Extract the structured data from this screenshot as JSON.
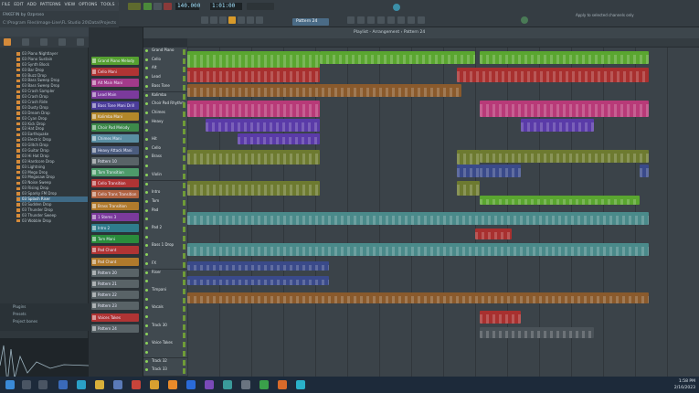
{
  "window": {
    "title": "FAKEFIN by Ozproso",
    "subtitle": "C:\\Program Files\\Image-Line\\FL Studio 20\\Data\\Projects"
  },
  "menu": [
    "FILE",
    "EDIT",
    "ADD",
    "PATTERNS",
    "VIEW",
    "OPTIONS",
    "TOOLS",
    "HELP"
  ],
  "transport": {
    "tempo": "140.000",
    "time": "1:01:00",
    "pattern": "Pattern 24",
    "hint": "Apply to selected channels only"
  },
  "playlist": {
    "title": "Playlist - Arrangement › Pattern 24"
  },
  "browser": {
    "items": [
      "03 Piano Nightlayer",
      "03 Piano Sustain",
      "03 Synth Block",
      "03 Bar Drop",
      "03 Buzz Drop",
      "03 Bass Sweep Drop",
      "03 Bass Sweep Drop",
      "03 Crash Sampler",
      "03 Crash Drop",
      "03 Crash Ride",
      "03 Dusty Drop",
      "03 Dream Drop",
      "03 Cyan Drop",
      "03 Kick Drop",
      "03 Hat Drop",
      "03 Earthquake",
      "03 Electric Drop",
      "03 Glitch Drop",
      "03 Guitar Drop",
      "03 Hi Hat Drop",
      "03 Hardcore Drop",
      "03 Lightning",
      "03 Mega Drop",
      "03 Megasaw Drop",
      "03 Noise Sweep",
      "03 Rising Drop",
      "03 Sparky FM Drop",
      "03 Splash Riser",
      "03 Sudden Drop",
      "03 Thunder Drop",
      "03 Thunder Sweep",
      "03 Wobble Drop"
    ],
    "selected_index": 27,
    "footer": [
      "Plugins",
      "Presets",
      "Project bones"
    ]
  },
  "picker": {
    "items": [
      {
        "label": "Grand Piano Melody",
        "color": "#55a030"
      },
      {
        "label": "Cello Mani",
        "color": "#b03434"
      },
      {
        "label": "Alt Main Mani",
        "color": "#a23a8a"
      },
      {
        "label": "Lead Main",
        "color": "#7b3a9c"
      },
      {
        "label": "Bass Tone Mani Drill",
        "color": "#4b3d9a"
      },
      {
        "label": "Kalimba Mani",
        "color": "#b3882a"
      },
      {
        "label": "Choir Pad Melody",
        "color": "#3d8a4a"
      },
      {
        "label": "Chimes Mani",
        "color": "#5a8ea2"
      },
      {
        "label": "Heavy Attack Mani",
        "color": "#4b5c7e"
      },
      {
        "label": "Pattern 10",
        "color": "#596367"
      },
      {
        "label": "Tom Transition",
        "color": "#4d9b6a"
      },
      {
        "label": "Cello Transition",
        "color": "#b03434"
      },
      {
        "label": "Cello Trans Transition",
        "color": "#b06240"
      },
      {
        "label": "Brass Transition",
        "color": "#b07a2c"
      },
      {
        "label": "1 Stems 3",
        "color": "#7b3a9c"
      },
      {
        "label": "Intro 2",
        "color": "#2f7c8c"
      },
      {
        "label": "Tom Mani",
        "color": "#2a8c3c"
      },
      {
        "label": "Pad Chant",
        "color": "#b03434"
      },
      {
        "label": "Pad Chant",
        "color": "#b07a2c"
      },
      {
        "label": "Pattern 20",
        "color": "#596367"
      },
      {
        "label": "Pattern 21",
        "color": "#596367"
      },
      {
        "label": "Pattern 22",
        "color": "#596367"
      },
      {
        "label": "Pattern 23",
        "color": "#596367"
      },
      {
        "label": "Voices Takes",
        "color": "#b03434"
      },
      {
        "label": "Pattern 24",
        "color": "#596367"
      }
    ]
  },
  "tracks": [
    "Grand Piano",
    "Cello",
    "Alt",
    "Lead",
    "Bass Tone",
    "Kalimba",
    "Choir Pad Rhythm",
    "Chimes",
    "Heavy",
    "",
    "Hit",
    "Cello",
    "Brass",
    "",
    "Violin",
    "",
    "Intro",
    "Tom",
    "Pad",
    "",
    "Pad 2",
    "",
    "Bass 1 Drop",
    "",
    "FX",
    "Riser",
    "",
    "Timpani",
    "",
    "Vocals",
    "",
    "Track 30",
    "",
    "Voice Takes",
    "",
    "Track 32",
    "Track 33"
  ],
  "taskbar": {
    "time": "1:58 PM",
    "date": "2/16/2023"
  },
  "colors": {
    "green": "#5aa630",
    "red": "#a8302f",
    "pink": "#b83a78",
    "purple": "#5a3ba8",
    "olive": "#6d7a30",
    "teal": "#4a8a8a",
    "orange": "#8a5a2c",
    "blue": "#3a4a8a"
  }
}
